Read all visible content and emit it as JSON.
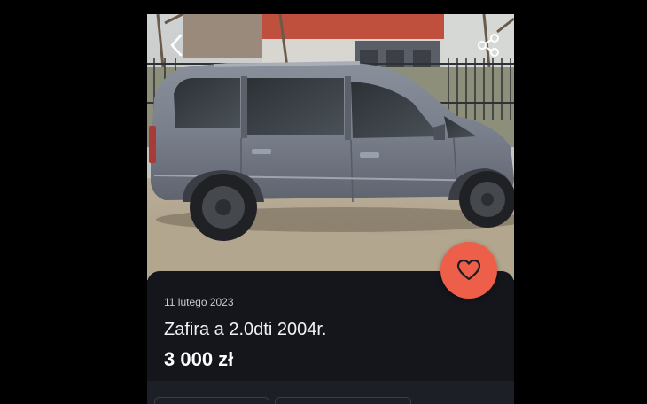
{
  "listing": {
    "date": "11 lutego 2023",
    "title": "Zafira a 2.0dti 2004r.",
    "price": "3 000 zł"
  },
  "icons": {
    "back": "chevron-left-icon",
    "share": "share-icon",
    "favorite": "heart-icon"
  },
  "colors": {
    "background": "#000000",
    "card": "#15161c",
    "accent": "#ee5f49",
    "text_primary": "#ffffff",
    "text_secondary": "#c9cad0"
  }
}
